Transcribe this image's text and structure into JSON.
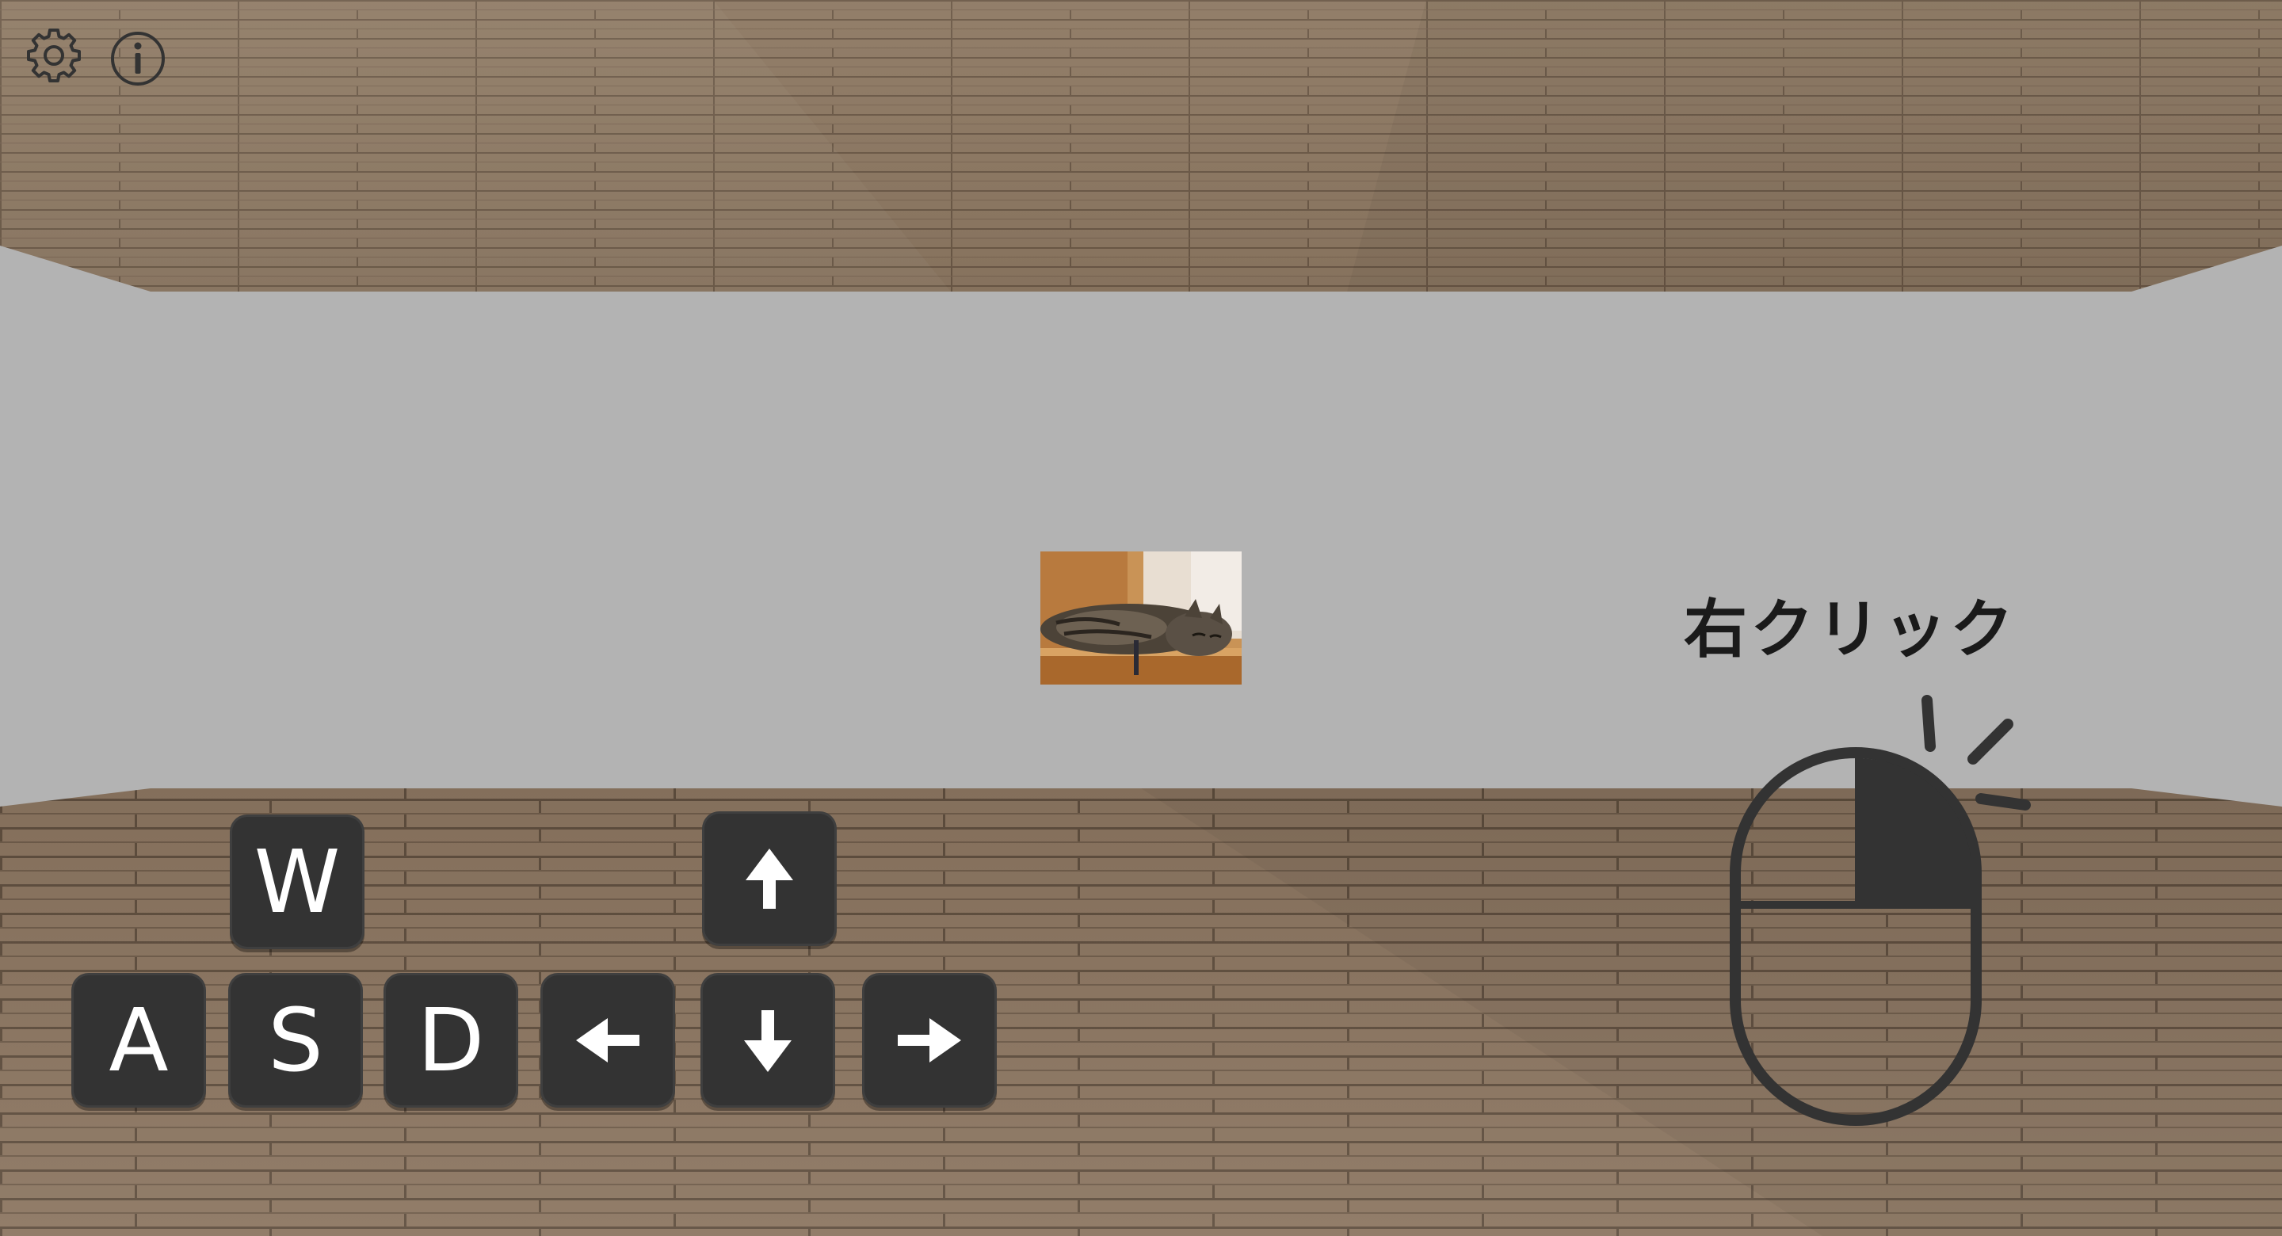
{
  "toolbar": {
    "settings_icon": "gear-icon",
    "info_icon": "info-icon"
  },
  "keys": {
    "w": "W",
    "a": "A",
    "s": "S",
    "d": "D",
    "up": "arrow-up-icon",
    "down": "arrow-down-icon",
    "left": "arrow-left-icon",
    "right": "arrow-right-icon"
  },
  "hint": {
    "label": "右クリック",
    "icon": "mouse-right-click-icon"
  },
  "painting": {
    "subject": "sleeping-cat-photo"
  },
  "colors": {
    "wall": "#b3b3b3",
    "wood": "#8a735c",
    "key_bg": "#333333",
    "key_fg": "#ffffff",
    "icon": "#333333"
  }
}
